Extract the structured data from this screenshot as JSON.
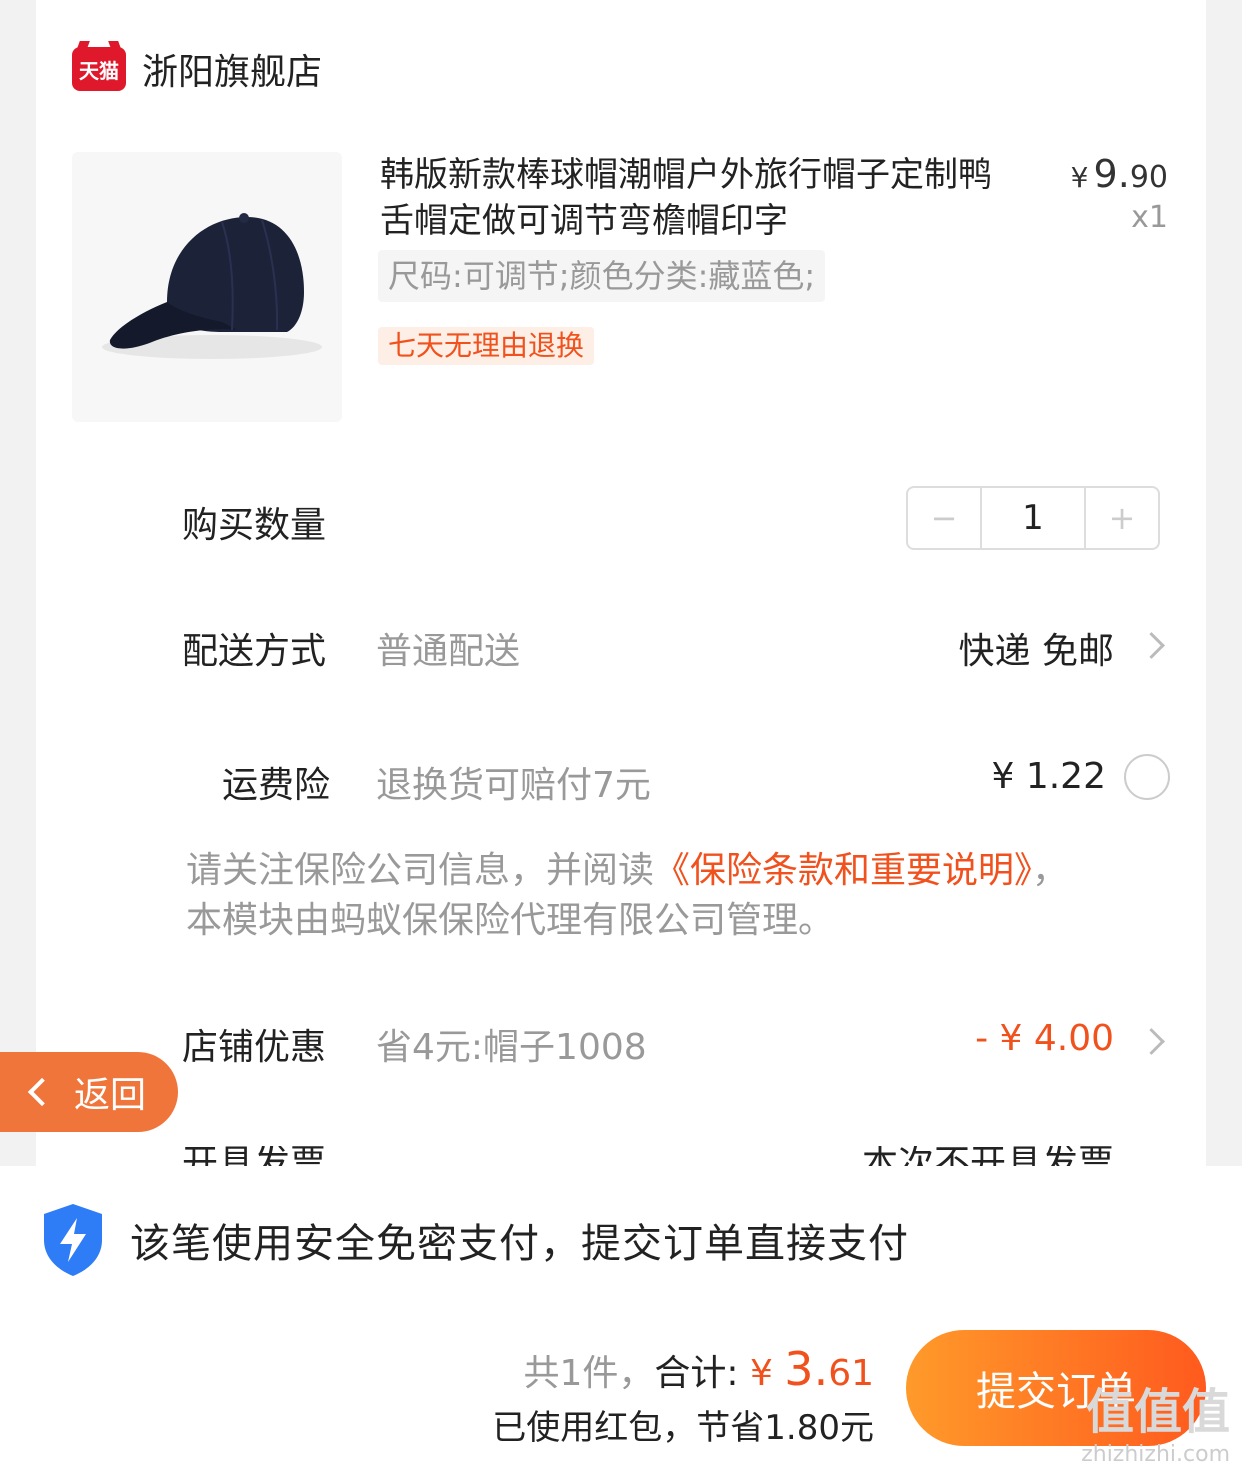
{
  "store": {
    "badge": "天猫",
    "name": "浙阳旗舰店"
  },
  "product": {
    "title": "韩版新款棒球帽潮帽户外旅行帽子定制鸭舌帽定做可调节弯檐帽印字",
    "price_symbol": "¥",
    "price_int": "9.",
    "price_dec": "90",
    "quantity_label": "x1",
    "sku": "尺码:可调节;颜色分类:藏蓝色;",
    "tag": "七天无理由退换"
  },
  "quantity": {
    "label": "购买数量",
    "minus": "−",
    "value": "1",
    "plus": "+"
  },
  "delivery": {
    "label": "配送方式",
    "sub": "普通配送",
    "value": "快递 免邮"
  },
  "insurance": {
    "label": "运费险",
    "sub": "退换货可赔付7元",
    "price": "¥ 1.22"
  },
  "notice": {
    "prefix": "请关注保险公司信息，并阅读",
    "link": "《保险条款和重要说明》",
    "suffix": "，本模块由蚂蚁保保险代理有限公司管理。"
  },
  "discount": {
    "label": "店铺优惠",
    "sub": "省4元:帽子1008",
    "value": "- ¥ 4.00"
  },
  "invoice": {
    "label": "开具发票",
    "value": "本次不开具发票"
  },
  "back": {
    "label": "返回"
  },
  "secure": {
    "text": "该笔使用安全免密支付，提交订单直接支付"
  },
  "totals": {
    "count": "共1件，",
    "label": "合计:",
    "symbol": "¥ ",
    "int": "3.",
    "dec": "61",
    "redpacket": "已使用红包，节省1.80元"
  },
  "submit": {
    "label": "提交订单"
  },
  "watermark": {
    "big": "值值值",
    "small": "zhizhizhi.com"
  },
  "colors": {
    "accent": "#f0511d",
    "tmall_red": "#e0182b",
    "back_orange": "#f0753a",
    "submit_start": "#ff9a2a",
    "submit_end": "#ff5a1e"
  }
}
